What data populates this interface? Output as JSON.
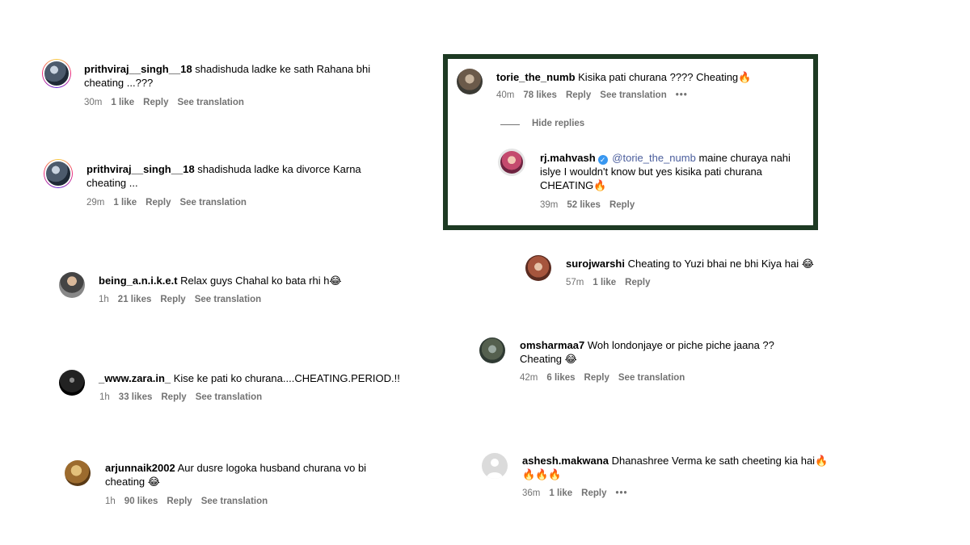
{
  "comments": [
    {
      "user": "prithviraj__singh__18",
      "text": "shadishuda ladke ke sath Rahana bhi cheating ...???",
      "time": "30m",
      "likes": "1 like",
      "reply": "Reply",
      "translate": "See translation"
    },
    {
      "user": "prithviraj__singh__18",
      "text": "shadishuda ladke ka divorce Karna cheating ...",
      "time": "29m",
      "likes": "1 like",
      "reply": "Reply",
      "translate": "See translation"
    },
    {
      "user": "being_a.n.i.k.e.t",
      "text": "Relax guys Chahal ko bata rhi h😂",
      "time": "1h",
      "likes": "21 likes",
      "reply": "Reply",
      "translate": "See translation"
    },
    {
      "user": "_www.zara.in_",
      "text": "Kise ke pati ko churana....CHEATING.PERIOD.!!",
      "time": "1h",
      "likes": "33 likes",
      "reply": "Reply",
      "translate": "See translation"
    },
    {
      "user": "arjunnaik2002",
      "text": "Aur dusre logoka husband churana vo bi cheating 😂",
      "time": "1h",
      "likes": "90 likes",
      "reply": "Reply",
      "translate": "See translation"
    },
    {
      "user": "torie_the_numb",
      "text": "Kisika pati churana ???? Cheating🔥",
      "time": "40m",
      "likes": "78 likes",
      "reply": "Reply",
      "translate": "See translation",
      "more": "•••"
    },
    {
      "user": "surojwarshi",
      "text": "Cheating to Yuzi bhai ne bhi Kiya hai 😂",
      "time": "57m",
      "likes": "1 like",
      "reply": "Reply"
    },
    {
      "user": "omsharmaa7",
      "text": "Woh londonjaye or piche piche jaana ?? Cheating 😂",
      "time": "42m",
      "likes": "6 likes",
      "reply": "Reply",
      "translate": "See translation"
    },
    {
      "user": "ashesh.makwana",
      "text": "Dhanashree Verma ke sath cheeting kia hai🔥",
      "text2": "🔥🔥🔥",
      "time": "36m",
      "likes": "1 like",
      "reply": "Reply",
      "more": "•••"
    }
  ],
  "reply_thread": {
    "hide_label": "Hide replies",
    "user": "rj.mahvash",
    "mention": "@torie_the_numb",
    "text_line1": "maine churaya nahi",
    "text_line2": "islye I wouldn't know but yes kisika pati churana",
    "text_line3": "CHEATING🔥",
    "time": "39m",
    "likes": "52 likes",
    "reply": "Reply"
  },
  "colors": {
    "highlight_border": "#1d3a23",
    "meta_gray": "#737373",
    "verified_blue": "#3897f0"
  }
}
